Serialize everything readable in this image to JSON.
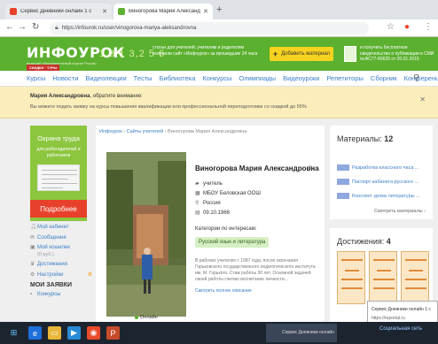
{
  "browser": {
    "tabs": [
      {
        "title": "Сервис Дневники онлайн 1 с",
        "active": false,
        "favicon_color": "#e8412b"
      },
      {
        "title": "Виногорова Мария Александ",
        "active": true,
        "favicon_color": "#5cb02f"
      }
    ],
    "new_tab": "+",
    "url": "https://infourok.ru/user/vinogorova-mariya-aleksandrovna"
  },
  "header": {
    "logo": "ИНФОУРОК",
    "logo_sub": "ведущий образовательный портал России",
    "new_badge": "СКИДКИ · ТУРЫ",
    "promo_numbers": "1,3 1 3,2 5 6",
    "promo_text": "статьи для учителей, учителям и родителям получили сайт «Инфоурок» за прошедшие 24 часа",
    "add_material": "Добавить материал",
    "cert_text": "и получить бесплатное свидетельство о публикации в СМИ №ФС77-60625 от 20.01.2015"
  },
  "nav": {
    "items": [
      "Курсы",
      "Новости",
      "Видеолекции",
      "Тесты",
      "Библиотека",
      "Конкурсы",
      "Олимпиады",
      "Видеоуроки",
      "Репетиторы",
      "Сборник",
      "Конференции"
    ]
  },
  "notice": {
    "name": "Мария Александровна",
    "attention": ", обратите внимание:",
    "text": "Вы можете подать заявку на курсы повышения квалификации или профессиональной переподготовки со скидкой до 55%"
  },
  "ad": {
    "title": "Охрана труда",
    "subtitle": "для работодателей и работников",
    "button": "Подробнее"
  },
  "sidebar": {
    "items": [
      {
        "label": "Мой кабинет",
        "icon": "person-icon"
      },
      {
        "label": "Сообщения",
        "icon": "mail-icon"
      },
      {
        "label": "Мой кошелек",
        "sub": "(0 руб.)",
        "icon": "wallet-icon"
      },
      {
        "label": "Достижения",
        "icon": "trophy-icon"
      },
      {
        "label": "Настройки",
        "icon": "gear-icon",
        "extra": "⚙"
      }
    ],
    "section": "МОИ ЗАЯВКИ",
    "section_item": "Конкурсы"
  },
  "breadcrumbs": {
    "home": "Инфоурок",
    "sep1": " › ",
    "teachers": "Сайты учителей",
    "sep2": " › ",
    "current": "Виногорова Мария Александровна"
  },
  "profile": {
    "name": "Виногорова Мария Александровна",
    "role": "учитель",
    "school": "МБОУ Беловская ООШ",
    "country": "Россия",
    "birthdate": "09.10.1966",
    "categories_label": "Категории по интересам:",
    "category": "Русский язык и литература",
    "bio": "В рабочих учителях с 1987 года, после окончания Горьковского государственного педагогического института им. М. Горького. Стаж работы 30 лет. Основной задачей своей работы считаю воспитание личности...",
    "bio_more": "Смотреть полное описание",
    "status": "Онлайн"
  },
  "materials": {
    "title": "Материалы:",
    "count": "12",
    "items": [
      "Разработка классного часа ...",
      "Паспорт кабинета русского ...",
      "Конспект урока литературы ..."
    ],
    "all": "Смотреть материалы ›"
  },
  "achievements": {
    "title": "Достижения:",
    "count": "4"
  },
  "popup": {
    "title": "Сервис Дневники онлайн 1 с",
    "url": "https://reportal.ru"
  },
  "taskbar": {
    "active_label": "Сервис Дневники онлайн",
    "right_text": "Социальная сеть"
  }
}
